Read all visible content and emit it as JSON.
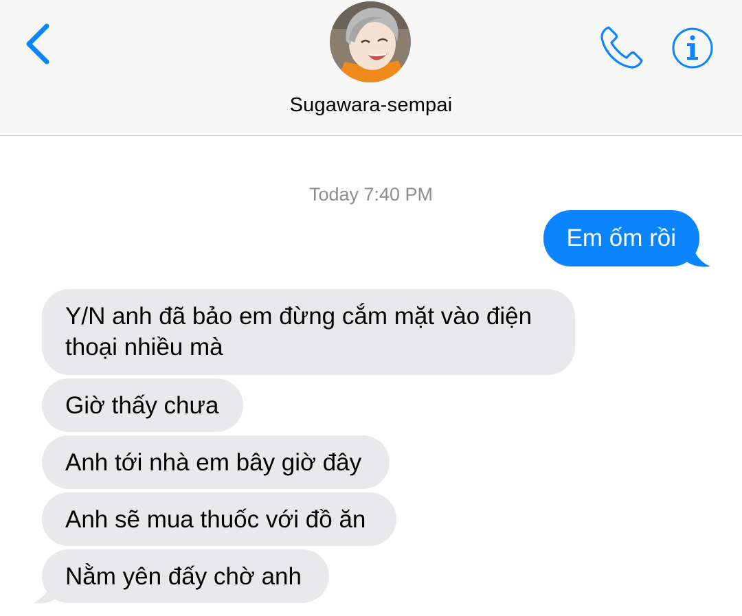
{
  "header": {
    "contact_name": "Sugawara-sempai",
    "back_icon": "chevron-left-icon",
    "call_icon": "phone-icon",
    "info_icon": "info-icon",
    "info_glyph": "i",
    "accent_color": "#0a84ff"
  },
  "conversation": {
    "timestamp": "Today 7:40 PM",
    "sent": [
      {
        "text": "Em ốm rồi"
      }
    ],
    "received": [
      {
        "line1": "Y/N anh đã bảo em đừng cắm mặt vào điện",
        "line2": "thoại nhiều mà"
      },
      {
        "text": "Giờ thấy chưa"
      },
      {
        "text": "Anh tới nhà em bây giờ đây"
      },
      {
        "text": "Anh sẽ mua thuốc với đồ ăn"
      },
      {
        "text": "Nằm yên đấy chờ anh"
      }
    ],
    "sent_bubble_color": "#0a84ff",
    "received_bubble_color": "#e9e9eb"
  }
}
